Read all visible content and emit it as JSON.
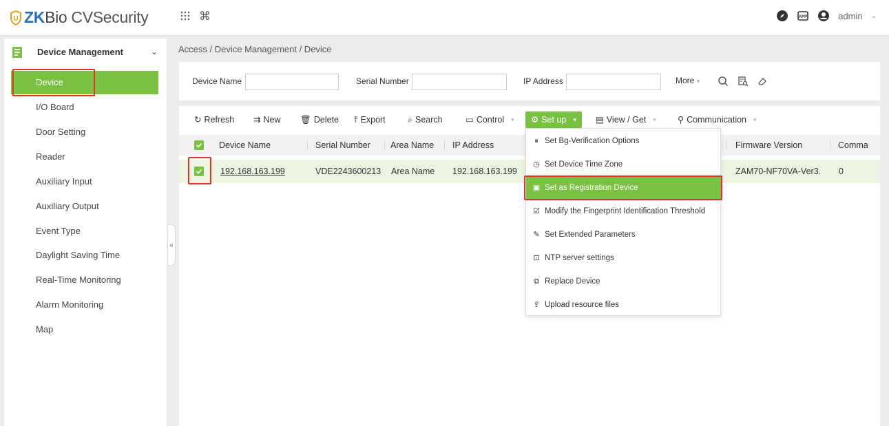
{
  "header": {
    "logo_brand_zk": "ZK",
    "logo_brand_bio": "Bio",
    "logo_product": "CVSecurity",
    "user_name": "admin",
    "icons": [
      "apps-grid-icon",
      "command-icon",
      "compass-icon",
      "app-download-icon",
      "user-circle-icon",
      "chevron-down-icon"
    ]
  },
  "sidebar": {
    "module_title": "Device Management",
    "items": [
      {
        "label": "Device",
        "active": true
      },
      {
        "label": "I/O Board"
      },
      {
        "label": "Door Setting"
      },
      {
        "label": "Reader"
      },
      {
        "label": "Auxiliary Input"
      },
      {
        "label": "Auxiliary Output"
      },
      {
        "label": "Event Type"
      },
      {
        "label": "Daylight Saving Time"
      },
      {
        "label": "Real-Time Monitoring"
      },
      {
        "label": "Alarm Monitoring"
      },
      {
        "label": "Map"
      }
    ],
    "collapse_glyph": "«"
  },
  "breadcrumb": "Access / Device Management / Device",
  "search": {
    "device_name_label": "Device Name",
    "serial_number_label": "Serial Number",
    "ip_address_label": "IP Address",
    "more_label": "More"
  },
  "toolbar": {
    "refresh": "Refresh",
    "new": "New",
    "delete": "Delete",
    "export": "Export",
    "search": "Search",
    "control": "Control",
    "setup": "Set up",
    "view_get": "View / Get",
    "communication": "Communication"
  },
  "table": {
    "columns": [
      "Device Name",
      "Serial Number",
      "Area Name",
      "IP Address",
      "Firmware Version",
      "Comma"
    ],
    "rows": [
      {
        "device_name": "192.168.163.199",
        "serial_number": "VDE2243600213",
        "area_name": "Area Name",
        "ip_address": "192.168.163.199",
        "firmware_version": "ZAM70-NF70VA-Ver3.",
        "commands": "0",
        "checked": true
      }
    ]
  },
  "setup_menu": {
    "items": [
      {
        "label": "Set Bg-Verification Options",
        "icon": "bg-verification-icon"
      },
      {
        "label": "Set Device Time Zone",
        "icon": "time-zone-icon"
      },
      {
        "label": "Set as Registration Device",
        "icon": "registration-device-icon",
        "active": true
      },
      {
        "label": "Modify the Fingerprint Identification Threshold",
        "icon": "fingerprint-threshold-icon"
      },
      {
        "label": "Set Extended Parameters",
        "icon": "extended-parameters-icon"
      },
      {
        "label": "NTP server settings",
        "icon": "ntp-server-icon"
      },
      {
        "label": "Replace Device",
        "icon": "replace-device-icon"
      },
      {
        "label": "Upload resource files",
        "icon": "upload-files-icon"
      }
    ]
  },
  "colors": {
    "accent_green": "#7ac143",
    "highlight_red": "#e0312e",
    "brand_blue": "#2a6fb5"
  }
}
